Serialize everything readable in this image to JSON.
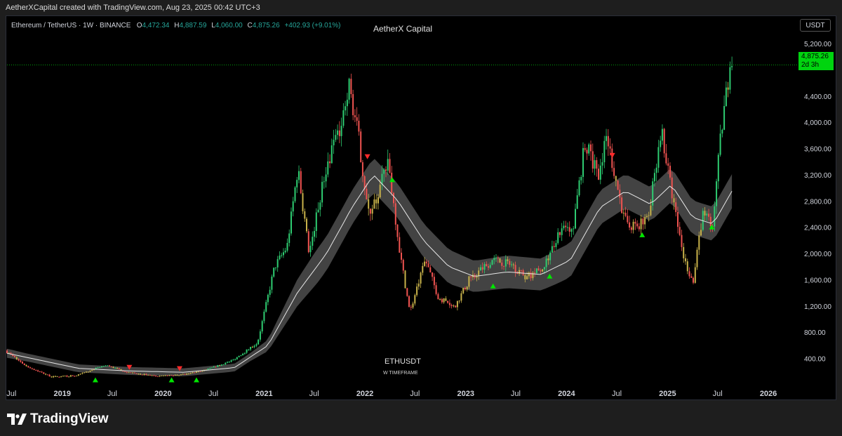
{
  "header": {
    "creator": "AetherXCapital created with TradingView.com, Aug 23, 2025 00:42 UTC+3"
  },
  "legend": {
    "symbol": "Ethereum / TetherUS · 1W · BINANCE",
    "open_label": "O",
    "open": "4,472.34",
    "high_label": "H",
    "high": "4,887.59",
    "low_label": "L",
    "low": "4,060.00",
    "close_label": "C",
    "close": "4,875.26",
    "change": "+402.93 (+9.01%)"
  },
  "chart_title": "AetherX Capital",
  "currency": "USDT",
  "last_price": {
    "value": "4,875.26",
    "countdown": "2d 3h",
    "color": "#00d40f"
  },
  "watermark": {
    "symbol": "ETHUSDT",
    "timeframe": "W TIMEFRAME"
  },
  "branding": {
    "name": "TradingView"
  },
  "colors": {
    "up": "#26a69a",
    "bull_bright": "#2ecc71",
    "down": "#ef5350",
    "neutral": "#c8b24a",
    "band": "#5a5a5a",
    "mid_line": "#e6e6e6"
  },
  "chart_data": {
    "type": "line",
    "title": "AetherX Capital",
    "xlabel": "",
    "ylabel": "",
    "y_scale": "linear",
    "ylim": [
      0,
      5200
    ],
    "xlim": [
      "2018-06-15",
      "2026-04-15"
    ],
    "grid": false,
    "x_ticks": [
      {
        "label": "Jul",
        "date": "2018-07-01"
      },
      {
        "label": "2019",
        "date": "2019-01-01"
      },
      {
        "label": "Jul",
        "date": "2019-07-01"
      },
      {
        "label": "2020",
        "date": "2020-01-01"
      },
      {
        "label": "Jul",
        "date": "2020-07-01"
      },
      {
        "label": "2021",
        "date": "2021-01-01"
      },
      {
        "label": "Jul",
        "date": "2021-07-01"
      },
      {
        "label": "2022",
        "date": "2022-01-01"
      },
      {
        "label": "Jul",
        "date": "2022-07-01"
      },
      {
        "label": "2023",
        "date": "2023-01-01"
      },
      {
        "label": "Jul",
        "date": "2023-07-01"
      },
      {
        "label": "2024",
        "date": "2024-01-01"
      },
      {
        "label": "Jul",
        "date": "2024-07-01"
      },
      {
        "label": "2025",
        "date": "2025-01-01"
      },
      {
        "label": "Jul",
        "date": "2025-07-01"
      },
      {
        "label": "2026",
        "date": "2026-01-01"
      }
    ],
    "y_ticks": [
      {
        "label": "400.00",
        "value": 400
      },
      {
        "label": "800.00",
        "value": 800
      },
      {
        "label": "1,200.00",
        "value": 1200
      },
      {
        "label": "1,600.00",
        "value": 1600
      },
      {
        "label": "2,000.00",
        "value": 2000
      },
      {
        "label": "2,400.00",
        "value": 2400
      },
      {
        "label": "2,800.00",
        "value": 2800
      },
      {
        "label": "3,200.00",
        "value": 3200
      },
      {
        "label": "3,600.00",
        "value": 3600
      },
      {
        "label": "4,000.00",
        "value": 4000
      },
      {
        "label": "4,400.00",
        "value": 4400
      },
      {
        "label": "5,200.00",
        "value": 5200
      }
    ],
    "price_line": 4875.26,
    "series": [
      {
        "role": "price",
        "x": [
          "2018-06-15",
          "2018-09-01",
          "2018-12-01",
          "2019-03-01",
          "2019-06-15",
          "2019-09-01",
          "2019-12-15",
          "2020-03-15",
          "2020-06-15",
          "2020-09-15",
          "2020-12-15",
          "2021-02-15",
          "2021-04-01",
          "2021-05-10",
          "2021-06-20",
          "2021-08-15",
          "2021-09-10",
          "2021-10-15",
          "2021-11-10",
          "2021-12-15",
          "2022-01-20",
          "2022-02-25",
          "2022-04-01",
          "2022-05-15",
          "2022-06-20",
          "2022-08-15",
          "2022-10-01",
          "2022-12-01",
          "2023-01-20",
          "2023-04-15",
          "2023-06-15",
          "2023-08-15",
          "2023-10-15",
          "2023-12-15",
          "2024-02-01",
          "2024-03-15",
          "2024-05-01",
          "2024-06-01",
          "2024-08-05",
          "2024-09-15",
          "2024-11-01",
          "2024-12-15",
          "2025-02-01",
          "2025-03-10",
          "2025-04-10",
          "2025-05-15",
          "2025-06-20",
          "2025-07-20",
          "2025-08-22"
        ],
        "values": [
          520,
          280,
          120,
          140,
          300,
          190,
          130,
          150,
          230,
          370,
          640,
          1800,
          2100,
          3300,
          2000,
          3200,
          3600,
          4000,
          4600,
          3800,
          2600,
          2900,
          3450,
          2000,
          1100,
          1900,
          1330,
          1200,
          1600,
          1900,
          1850,
          1640,
          1780,
          2350,
          2400,
          3700,
          3200,
          3800,
          2500,
          2400,
          2600,
          3900,
          2700,
          1900,
          1550,
          2600,
          2450,
          3800,
          4875
        ]
      },
      {
        "role": "moving-average",
        "x": [
          "2018-06-15",
          "2019-03-01",
          "2019-09-01",
          "2020-03-15",
          "2020-09-15",
          "2021-01-15",
          "2021-05-01",
          "2021-08-15",
          "2021-11-15",
          "2022-02-01",
          "2022-05-01",
          "2022-08-01",
          "2022-11-01",
          "2023-02-01",
          "2023-06-01",
          "2023-10-01",
          "2024-01-15",
          "2024-05-01",
          "2024-08-01",
          "2024-11-01",
          "2025-01-15",
          "2025-04-01",
          "2025-06-15",
          "2025-08-22"
        ],
        "values": [
          480,
          250,
          210,
          190,
          260,
          600,
          1400,
          2000,
          2700,
          3200,
          2800,
          2200,
          1800,
          1650,
          1720,
          1680,
          1900,
          2700,
          2950,
          2750,
          3050,
          2550,
          2450,
          2950
        ],
        "band": 260
      }
    ],
    "markers": [
      {
        "type": "buy",
        "date": "2019-05-01",
        "value": 70
      },
      {
        "type": "sell",
        "date": "2019-09-01",
        "value": 270
      },
      {
        "type": "buy",
        "date": "2020-02-01",
        "value": 70
      },
      {
        "type": "sell",
        "date": "2020-03-01",
        "value": 250
      },
      {
        "type": "buy",
        "date": "2020-05-01",
        "value": 70
      },
      {
        "type": "sell",
        "date": "2022-01-10",
        "value": 3480
      },
      {
        "type": "buy",
        "date": "2022-04-10",
        "value": 3120
      },
      {
        "type": "buy",
        "date": "2023-04-10",
        "value": 1500
      },
      {
        "type": "buy",
        "date": "2023-11-01",
        "value": 1650
      },
      {
        "type": "sell",
        "date": "2024-06-15",
        "value": 3500
      },
      {
        "type": "buy",
        "date": "2024-10-01",
        "value": 2280
      },
      {
        "type": "buy",
        "date": "2025-06-10",
        "value": 2400
      }
    ]
  }
}
